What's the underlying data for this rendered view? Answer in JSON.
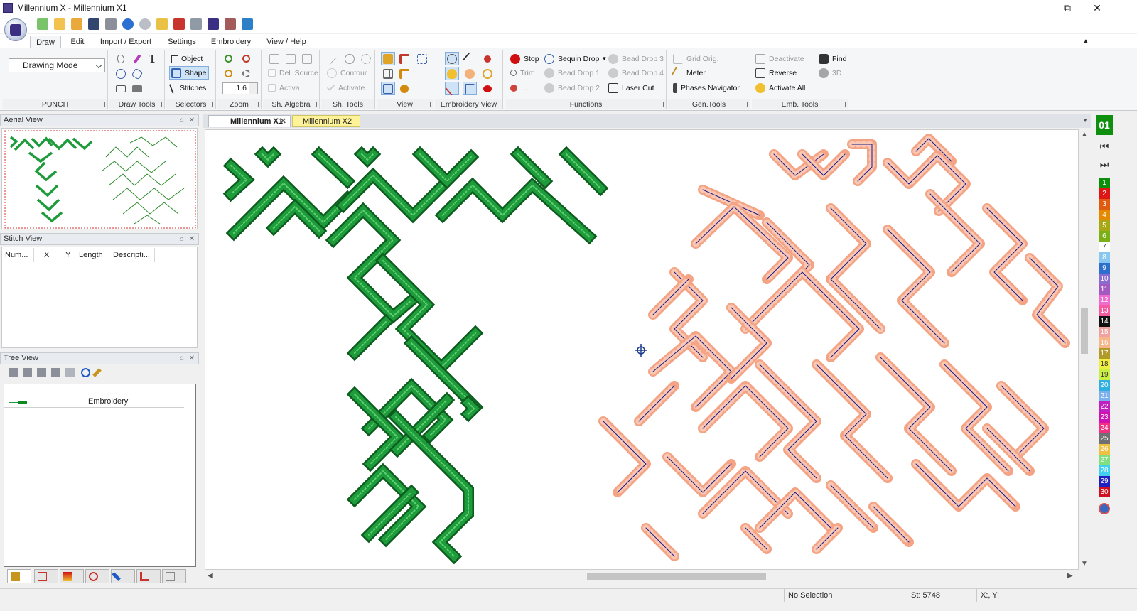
{
  "window": {
    "title": "Millennium X - Millennium X1",
    "min_label": "—",
    "restore_label": "⧉",
    "close_label": "✕",
    "ribbon_collapse_label": "▲"
  },
  "ribbon_tabs": [
    "Draw",
    "Edit",
    "Import / Export",
    "Settings",
    "Embroidery",
    "View / Help"
  ],
  "punch": {
    "mode_value": "Drawing Mode",
    "label": "PUNCH"
  },
  "groups": {
    "draw_tools": "Draw Tools",
    "selectors": "Selectors",
    "zoom": "Zoom",
    "sh_algebra": "Sh. Algebra",
    "sh_tools": "Sh. Tools",
    "view": "View",
    "embroidery_view": "Embroidery View",
    "functions": "Functions",
    "gen_tools": "Gen.Tools",
    "emb_tools": "Emb. Tools"
  },
  "selectors": {
    "object": "Object",
    "shape": "Shape",
    "stitches": "Stitches"
  },
  "zoom": {
    "value": "1.6"
  },
  "sh_algebra": {
    "del_source": "Del. Source",
    "activa": "Activa"
  },
  "sh_tools": {
    "contour": "Contour",
    "activate": "Activate"
  },
  "functions": {
    "stop": "Stop",
    "trim": "Trim",
    "more": "...",
    "sequin_drop": "Sequin Drop",
    "bead_drop_1": "Bead Drop 1",
    "bead_drop_2": "Bead Drop 2",
    "bead_drop_3": "Bead Drop 3",
    "bead_drop_4": "Bead Drop 4",
    "laser_cut": "Laser Cut"
  },
  "gen_tools": {
    "grid_orig": "Grid Orig.",
    "meter": "Meter",
    "phases_navigator": "Phases Navigator"
  },
  "emb_tools": {
    "deactivate": "Deactivate",
    "reverse": "Reverse",
    "activate_all": "Activate All",
    "find": "Find",
    "three_d": "3D"
  },
  "panels": {
    "aerial_view": "Aerial View",
    "stitch_view": "Stitch View",
    "tree_view": "Tree View",
    "pin_label": "⌂",
    "close_label": "✕"
  },
  "stitch_columns": [
    "Num...",
    "X",
    "Y",
    "Length",
    "Descripti..."
  ],
  "tree": {
    "root_label": "Embroidery"
  },
  "document_tabs": [
    {
      "label": "Millennium X1",
      "close": "✕"
    },
    {
      "label": "Millennium X2"
    }
  ],
  "palette": {
    "current": "01",
    "first_label": "⏮",
    "last_label": "⏭",
    "colors": [
      {
        "n": "1",
        "c": "#0b8f0b"
      },
      {
        "n": "2",
        "c": "#e01515"
      },
      {
        "n": "3",
        "c": "#e05a10"
      },
      {
        "n": "4",
        "c": "#e58a00"
      },
      {
        "n": "5",
        "c": "#a8a814"
      },
      {
        "n": "6",
        "c": "#7ab015"
      },
      {
        "n": "7",
        "c": "#ffffff"
      },
      {
        "n": "8",
        "c": "#87c7f0"
      },
      {
        "n": "9",
        "c": "#2d6fcf"
      },
      {
        "n": "10",
        "c": "#8a6bcf"
      },
      {
        "n": "11",
        "c": "#a25ac0"
      },
      {
        "n": "12",
        "c": "#f06ad0"
      },
      {
        "n": "13",
        "c": "#f55aa0"
      },
      {
        "n": "14",
        "c": "#111111"
      },
      {
        "n": "15",
        "c": "#f3a0a0"
      },
      {
        "n": "16",
        "c": "#f5b68a"
      },
      {
        "n": "17",
        "c": "#b09a2a"
      },
      {
        "n": "18",
        "c": "#f0ee40"
      },
      {
        "n": "19",
        "c": "#c8f040"
      },
      {
        "n": "20",
        "c": "#30b0e0"
      },
      {
        "n": "21",
        "c": "#7ab0f0"
      },
      {
        "n": "22",
        "c": "#c020c0"
      },
      {
        "n": "23",
        "c": "#d010b0"
      },
      {
        "n": "24",
        "c": "#f03080"
      },
      {
        "n": "25",
        "c": "#707070"
      },
      {
        "n": "26",
        "c": "#f0c040"
      },
      {
        "n": "27",
        "c": "#80e080"
      },
      {
        "n": "28",
        "c": "#40d0f0"
      },
      {
        "n": "29",
        "c": "#2020c0"
      },
      {
        "n": "30",
        "c": "#d01020"
      }
    ]
  },
  "status": {
    "selection": "No Selection",
    "stitches": "St: 5748",
    "coords": "X:, Y:"
  },
  "colors": {
    "green_embroidery": "#1e9b3a",
    "green_dark": "#0d5c1f",
    "salmon_embroidery": "#f4a384",
    "stitch_line": "#1a1a8c"
  }
}
